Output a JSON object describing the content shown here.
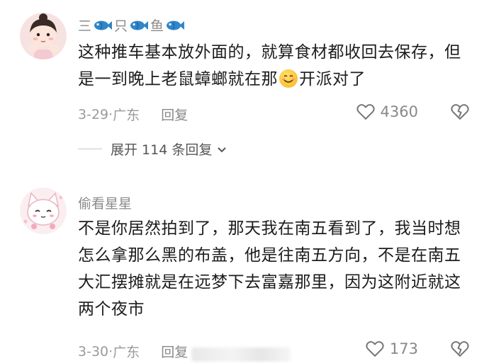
{
  "comments": [
    {
      "username": "三🐟只🐟鱼🐟",
      "username_parts": [
        "三",
        "只",
        "鱼"
      ],
      "text_before_emoji": "这种推车基本放外面的，就算食材都收回去保存，但是一到晚上老鼠蟑螂就在那",
      "text_after_emoji": "开派对了",
      "date": "3-29",
      "location": "广东",
      "reply_label": "回复",
      "likes": "4360",
      "expand_label": "展开 114 条回复"
    },
    {
      "username": "偷看星星",
      "text": "不是你居然拍到了，那天我在南五看到了，我当时想怎么拿那么黑的布盖，他是往南五方向，不是在南五大汇摆摊就是在远梦下去富嘉那里，因为这附近就这两个夜市",
      "date": "3-30",
      "location": "广东",
      "reply_label": "回复",
      "likes": "173"
    }
  ],
  "icons": {
    "fish": "fish-emoji-icon",
    "like": "heart-outline-icon",
    "dislike": "broken-heart-icon",
    "expand": "chevron-down-icon",
    "smile": "smiling-face-emoji-icon"
  },
  "colors": {
    "fish_blue": "#2f86c9",
    "meta_gray": "#9a9a9a"
  }
}
